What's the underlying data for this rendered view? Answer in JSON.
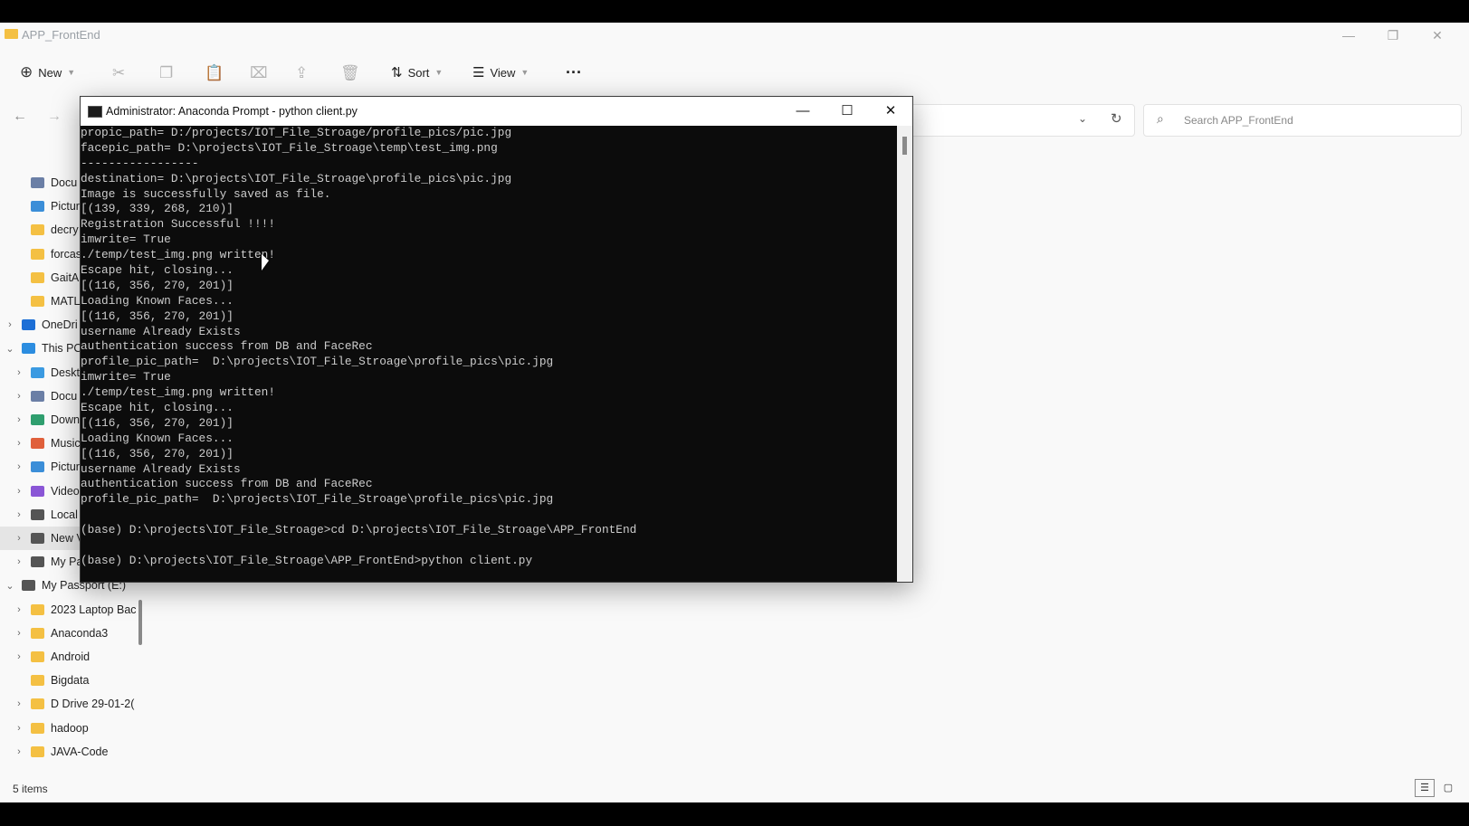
{
  "explorer": {
    "title": "APP_FrontEnd",
    "toolbar": {
      "new_label": "New",
      "sort_label": "Sort",
      "view_label": "View"
    },
    "search_placeholder": "Search APP_FrontEnd",
    "sidebar": [
      {
        "label": "Docu",
        "icon": "document-icon",
        "chevron": "",
        "color": "#6b7fa6"
      },
      {
        "label": "Pictur",
        "icon": "pictures-icon",
        "chevron": "",
        "color": "#3b8ed8"
      },
      {
        "label": "decry",
        "icon": "folder-icon",
        "chevron": "",
        "color": "#f4c043"
      },
      {
        "label": "forcas",
        "icon": "folder-icon",
        "chevron": "",
        "color": "#f4c043"
      },
      {
        "label": "GaitA",
        "icon": "folder-icon",
        "chevron": "",
        "color": "#f4c043"
      },
      {
        "label": "MATL",
        "icon": "folder-icon",
        "chevron": "",
        "color": "#f4c043"
      },
      {
        "label": "OneDri",
        "icon": "cloud-icon",
        "chevron": "›",
        "color": "#1d6fd6",
        "indent": 1
      },
      {
        "label": "This PC",
        "icon": "computer-icon",
        "chevron": "⌄",
        "color": "#2c8de0",
        "indent": 1
      },
      {
        "label": "Deskt",
        "icon": "desktop-icon",
        "chevron": "›",
        "color": "#3b9ae1"
      },
      {
        "label": "Docu",
        "icon": "document-icon",
        "chevron": "›",
        "color": "#6b7fa6"
      },
      {
        "label": "Down",
        "icon": "download-icon",
        "chevron": "›",
        "color": "#2f9e6e"
      },
      {
        "label": "Music",
        "icon": "music-icon",
        "chevron": "›",
        "color": "#e0603b"
      },
      {
        "label": "Pictur",
        "icon": "pictures-icon",
        "chevron": "›",
        "color": "#3b8ed8"
      },
      {
        "label": "Video",
        "icon": "video-icon",
        "chevron": "›",
        "color": "#8a56d6"
      },
      {
        "label": "Local",
        "icon": "drive-icon",
        "chevron": "›",
        "color": "#555"
      },
      {
        "label": "New V",
        "icon": "drive-icon",
        "chevron": "›",
        "color": "#555",
        "selected": true
      },
      {
        "label": "My Pa",
        "icon": "drive-icon",
        "chevron": "›",
        "color": "#555"
      },
      {
        "label": "My Passport (E:)",
        "icon": "drive-icon",
        "chevron": "⌄",
        "color": "#555",
        "indent": 1
      },
      {
        "label": "2023 Laptop Bac",
        "icon": "folder-icon",
        "chevron": "›",
        "color": "#f4c043"
      },
      {
        "label": "Anaconda3",
        "icon": "folder-icon",
        "chevron": "›",
        "color": "#f4c043"
      },
      {
        "label": "Android",
        "icon": "folder-icon",
        "chevron": "›",
        "color": "#f4c043"
      },
      {
        "label": "Bigdata",
        "icon": "folder-icon",
        "chevron": "",
        "color": "#f4c043"
      },
      {
        "label": "D Drive 29-01-2(",
        "icon": "folder-icon",
        "chevron": "›",
        "color": "#f4c043"
      },
      {
        "label": "hadoop",
        "icon": "folder-icon",
        "chevron": "›",
        "color": "#f4c043"
      },
      {
        "label": "JAVA-Code",
        "icon": "folder-icon",
        "chevron": "›",
        "color": "#f4c043"
      }
    ],
    "status": "5 items"
  },
  "terminal": {
    "title": "Administrator: Anaconda Prompt - python  client.py",
    "lines": [
      "propic_path= D:/projects/IOT_File_Stroage/profile_pics/pic.jpg",
      "facepic_path= D:\\projects\\IOT_File_Stroage\\temp\\test_img.png",
      "-----------------",
      "destination= D:\\projects\\IOT_File_Stroage\\profile_pics\\pic.jpg",
      "Image is successfully saved as file.",
      "[(139, 339, 268, 210)]",
      "Registration Successful !!!!",
      "imwrite= True",
      "./temp/test_img.png written!",
      "Escape hit, closing...",
      "[(116, 356, 270, 201)]",
      "Loading Known Faces...",
      "[(116, 356, 270, 201)]",
      "username Already Exists",
      "authentication success from DB and FaceRec",
      "profile_pic_path=  D:\\projects\\IOT_File_Stroage\\profile_pics\\pic.jpg",
      "imwrite= True",
      "./temp/test_img.png written!",
      "Escape hit, closing...",
      "[(116, 356, 270, 201)]",
      "Loading Known Faces...",
      "[(116, 356, 270, 201)]",
      "username Already Exists",
      "authentication success from DB and FaceRec",
      "profile_pic_path=  D:\\projects\\IOT_File_Stroage\\profile_pics\\pic.jpg",
      "",
      "(base) D:\\projects\\IOT_File_Stroage>cd D:\\projects\\IOT_File_Stroage\\APP_FrontEnd",
      "",
      "(base) D:\\projects\\IOT_File_Stroage\\APP_FrontEnd>python client.py"
    ]
  }
}
